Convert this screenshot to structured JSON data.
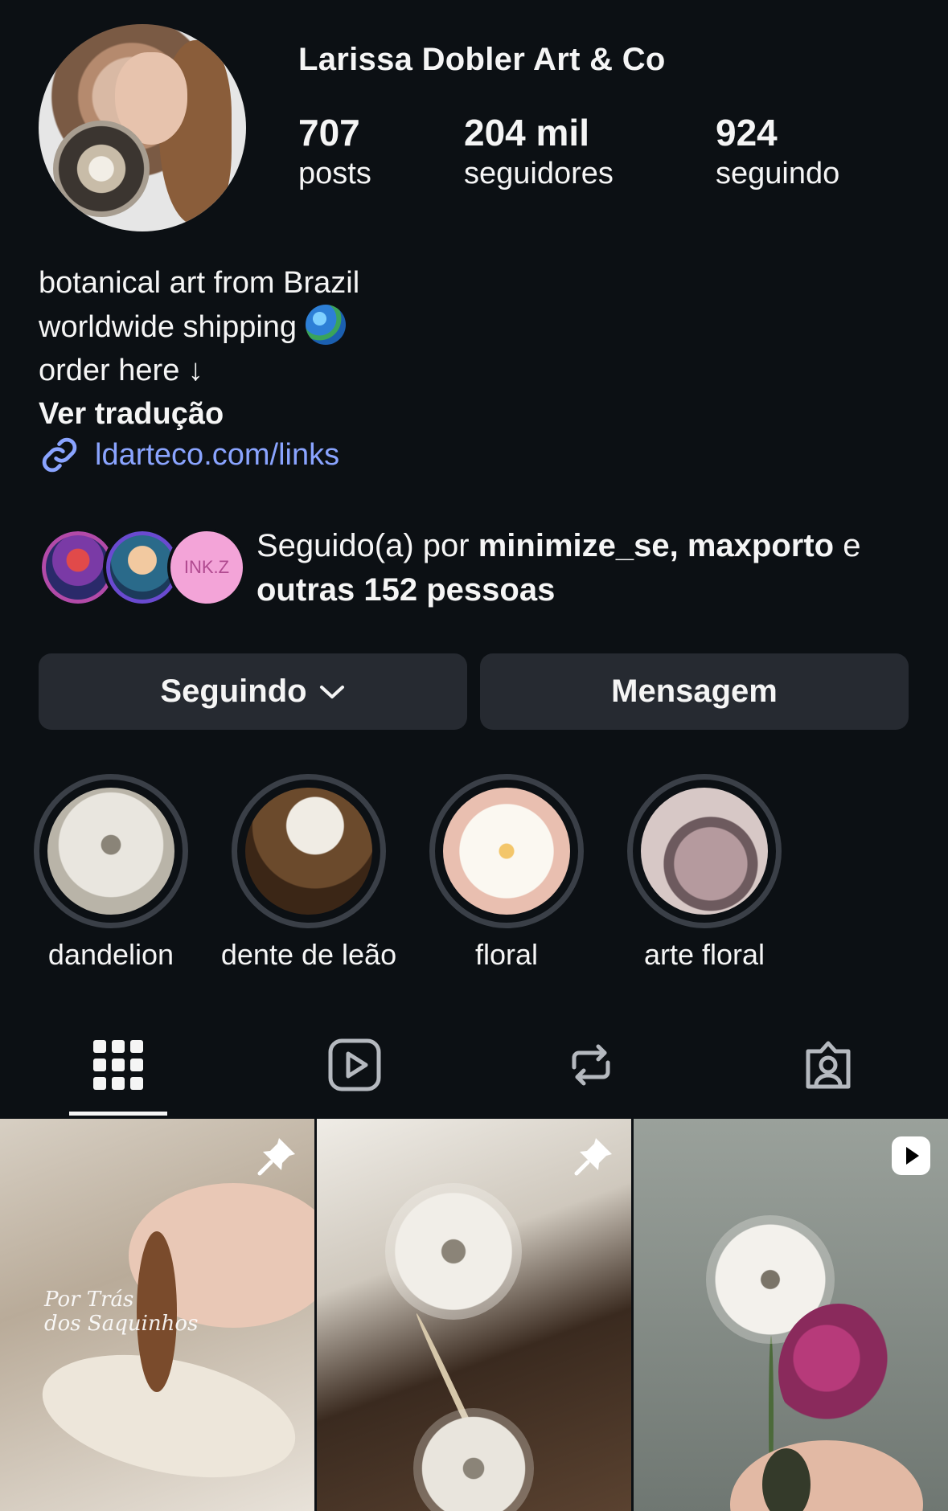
{
  "profile": {
    "name": "Larissa Dobler Art & Co",
    "stats": {
      "posts": {
        "value": "707",
        "label": "posts"
      },
      "followers": {
        "value": "204 mil",
        "label": "seguidores"
      },
      "following": {
        "value": "924",
        "label": "seguindo"
      }
    }
  },
  "bio": {
    "line1": "botanical art from Brazil",
    "line2": "worldwide shipping",
    "line3": "order here ↓",
    "translate": "Ver tradução",
    "link": "ldarteco.com/links"
  },
  "followed_by": {
    "prefix": "Seguido(a) por ",
    "users": "minimize_se, maxporto",
    "connector": " e ",
    "others": "outras 152 pessoas",
    "third_avatar_text": "INK.Z"
  },
  "buttons": {
    "following": "Seguindo",
    "message": "Mensagem"
  },
  "highlights": [
    {
      "label": "dandelion"
    },
    {
      "label": "dente de leão"
    },
    {
      "label": "floral"
    },
    {
      "label": "arte floral"
    }
  ],
  "tabs": [
    {
      "icon": "grid-icon",
      "active": true
    },
    {
      "icon": "reels-icon",
      "active": false
    },
    {
      "icon": "reposts-icon",
      "active": false
    },
    {
      "icon": "tagged-icon",
      "active": false
    }
  ],
  "posts": [
    {
      "badge": "pin-icon",
      "overlay_text_1": "Por Trás",
      "overlay_text_2": "dos Saquinhos"
    },
    {
      "badge": "pin-icon"
    },
    {
      "badge": "reel-icon"
    }
  ],
  "colors": {
    "background": "#0c1014",
    "button": "#262a31",
    "link": "#8aa4ff",
    "highlight_ring": "#3a3f47"
  }
}
